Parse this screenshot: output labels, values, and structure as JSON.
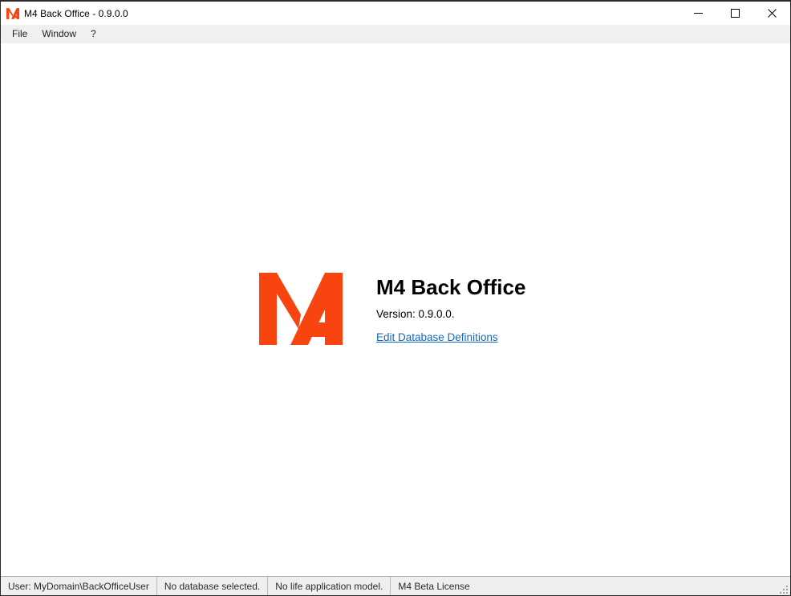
{
  "window": {
    "title": "M4 Back Office - 0.9.0.0",
    "icon": "m4-logo-icon",
    "controls": {
      "minimize": "minimize-icon",
      "maximize": "maximize-icon",
      "close": "close-icon"
    }
  },
  "menu": {
    "items": [
      {
        "label": "File"
      },
      {
        "label": "Window"
      },
      {
        "label": "?"
      }
    ]
  },
  "splash": {
    "logo_icon": "m4-logo-icon",
    "logo_color": "#f8450f",
    "product_title": "M4 Back Office",
    "version_text": "Version: 0.9.0.0.",
    "link_label": "Edit Database Definitions",
    "link_color": "#1168c4"
  },
  "status_bar": {
    "cells": [
      {
        "label": "User: MyDomain\\BackOfficeUser"
      },
      {
        "label": "No database selected."
      },
      {
        "label": "No life application model."
      },
      {
        "label": "M4 Beta License"
      }
    ],
    "grip_icon": "resize-grip-icon"
  }
}
